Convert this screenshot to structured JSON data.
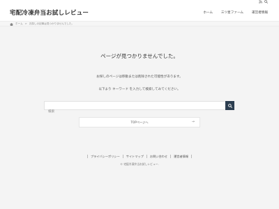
{
  "header": {
    "site_title": "宅配冷凍弁当お試しレビュー",
    "nav": [
      "ホーム",
      "三ツ星ファーム",
      "運営者情報"
    ],
    "icons": [
      "rss-icon",
      "search-icon"
    ]
  },
  "breadcrumb": {
    "home": "ホーム",
    "current": "お探しの記事は見つかりませんでした。"
  },
  "not_found": {
    "title": "ページが見つかりませんでした。",
    "text1": "お探しのページは移動または削除された可能性があります。",
    "text2": "以下より キーワード を入力して検索してみてください。"
  },
  "search": {
    "placeholder": "検索"
  },
  "top_link": {
    "label": "TOPページへ",
    "arrow": "→"
  },
  "footer": {
    "nav": [
      "プライバシーポリシー",
      "サイトマップ",
      "お問い合わせ",
      "運営者情報"
    ],
    "copyright": "© 宅配冷凍弁当お試しレビュー."
  },
  "colors": {
    "search_button": "#2c3e50",
    "background": "#f4f4f4"
  }
}
